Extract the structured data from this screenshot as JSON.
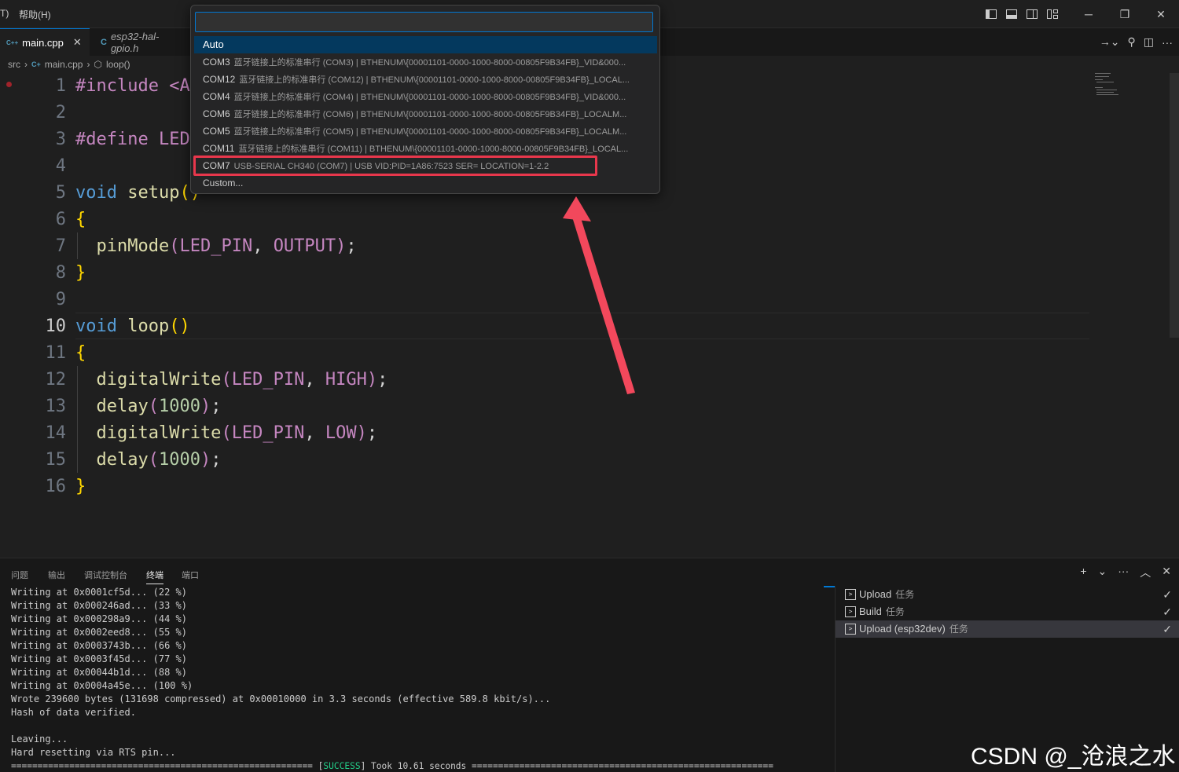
{
  "menu": {
    "partial_item": "T)",
    "help": "帮助(H)"
  },
  "window": {
    "layout_icons": [
      "toggle-primary-sidebar-icon",
      "toggle-panel-icon",
      "toggle-secondary-sidebar-icon",
      "customize-layout-icon"
    ],
    "minimize": "─",
    "restore": "❐",
    "close": "✕"
  },
  "tabs": [
    {
      "label": "main.cpp",
      "icon": "C++",
      "active": true,
      "close": "✕"
    },
    {
      "label": "esp32-hal-gpio.h",
      "icon": "C",
      "active": false
    }
  ],
  "breadcrumb": {
    "folder": "src",
    "file": "main.cpp",
    "symbol": "loop()"
  },
  "editor": {
    "line_numbers": [
      "1",
      "2",
      "3",
      "4",
      "5",
      "6",
      "7",
      "8",
      "9",
      "10",
      "11",
      "12",
      "13",
      "14",
      "15",
      "16"
    ],
    "lines": {
      "l1": "#include <A",
      "l3a": "#define ",
      "l3b": "LED",
      "l5a": "void",
      "l5b": " setup",
      "l5c": "()",
      "l6": "{",
      "l7a": "  pinMode",
      "l7b": "(",
      "l7c": "LED_PIN",
      "l7d": ", ",
      "l7e": "OUTPUT",
      "l7f": ")",
      "l7g": ";",
      "l8": "}",
      "l10a": "void",
      "l10b": " loop",
      "l10c": "()",
      "l11": "{",
      "l12a": "  digitalWrite",
      "l12b": "(",
      "l12c": "LED_PIN",
      "l12d": ", ",
      "l12e": "HIGH",
      "l12f": ")",
      "l12g": ";",
      "l13a": "  delay",
      "l13b": "(",
      "l13c": "1000",
      "l13d": ")",
      "l13e": ";",
      "l14a": "  digitalWrite",
      "l14b": "(",
      "l14c": "LED_PIN",
      "l14d": ", ",
      "l14e": "LOW",
      "l14f": ")",
      "l14g": ";",
      "l15a": "  delay",
      "l15b": "(",
      "l15c": "1000",
      "l15d": ")",
      "l15e": ";",
      "l16": "}"
    }
  },
  "quickpick": {
    "input_value": "",
    "items": [
      {
        "label": "Auto",
        "desc": ""
      },
      {
        "label": "COM3",
        "desc": "蓝牙链接上的标准串行 (COM3) | BTHENUM\\{00001101-0000-1000-8000-00805F9B34FB}_VID&000..."
      },
      {
        "label": "COM12",
        "desc": "蓝牙链接上的标准串行 (COM12) | BTHENUM\\{00001101-0000-1000-8000-00805F9B34FB}_LOCAL..."
      },
      {
        "label": "COM4",
        "desc": "蓝牙链接上的标准串行 (COM4) | BTHENUM\\{00001101-0000-1000-8000-00805F9B34FB}_VID&000..."
      },
      {
        "label": "COM6",
        "desc": "蓝牙链接上的标准串行 (COM6) | BTHENUM\\{00001101-0000-1000-8000-00805F9B34FB}_LOCALM..."
      },
      {
        "label": "COM5",
        "desc": "蓝牙链接上的标准串行 (COM5) | BTHENUM\\{00001101-0000-1000-8000-00805F9B34FB}_LOCALM..."
      },
      {
        "label": "COM11",
        "desc": "蓝牙链接上的标准串行 (COM11) | BTHENUM\\{00001101-0000-1000-8000-00805F9B34FB}_LOCAL..."
      },
      {
        "label": "COM7",
        "desc": "USB-SERIAL CH340 (COM7) | USB VID:PID=1A86:7523 SER= LOCATION=1-2.2"
      },
      {
        "label": "Custom...",
        "desc": ""
      }
    ],
    "highlight_color": "#e8374c"
  },
  "panel": {
    "tabs": [
      "问题",
      "输出",
      "调试控制台",
      "终端",
      "端口"
    ],
    "active_tab": "终端",
    "actions": {
      "add": "+",
      "dropdown": "⌄",
      "more": "···",
      "maximize": "︿",
      "close": "✕"
    },
    "terminal": {
      "lines": [
        "Writing at 0x0001cf5d... (22 %)",
        "Writing at 0x000246ad... (33 %)",
        "Writing at 0x000298a9... (44 %)",
        "Writing at 0x0002eed8... (55 %)",
        "Writing at 0x0003743b... (66 %)",
        "Writing at 0x0003f45d... (77 %)",
        "Writing at 0x00044b1d... (88 %)",
        "Writing at 0x0004a45e... (100 %)",
        "Wrote 239600 bytes (131698 compressed) at 0x00010000 in 3.3 seconds (effective 589.8 kbit/s)...",
        "Hash of data verified.",
        "",
        "Leaving...",
        "Hard resetting via RTS pin..."
      ],
      "last_pre": "========================================================= [",
      "last_success": "SUCCESS",
      "last_post": "] Took 10.61 seconds ========================================================="
    },
    "tasks": [
      {
        "label": "Upload",
        "tag": "任务",
        "check": "✓"
      },
      {
        "label": "Build",
        "tag": "任务",
        "check": "✓"
      },
      {
        "label": "Upload (esp32dev)",
        "tag": "任务",
        "check": "✓"
      }
    ]
  },
  "watermark": "CSDN @_沧浪之水_"
}
